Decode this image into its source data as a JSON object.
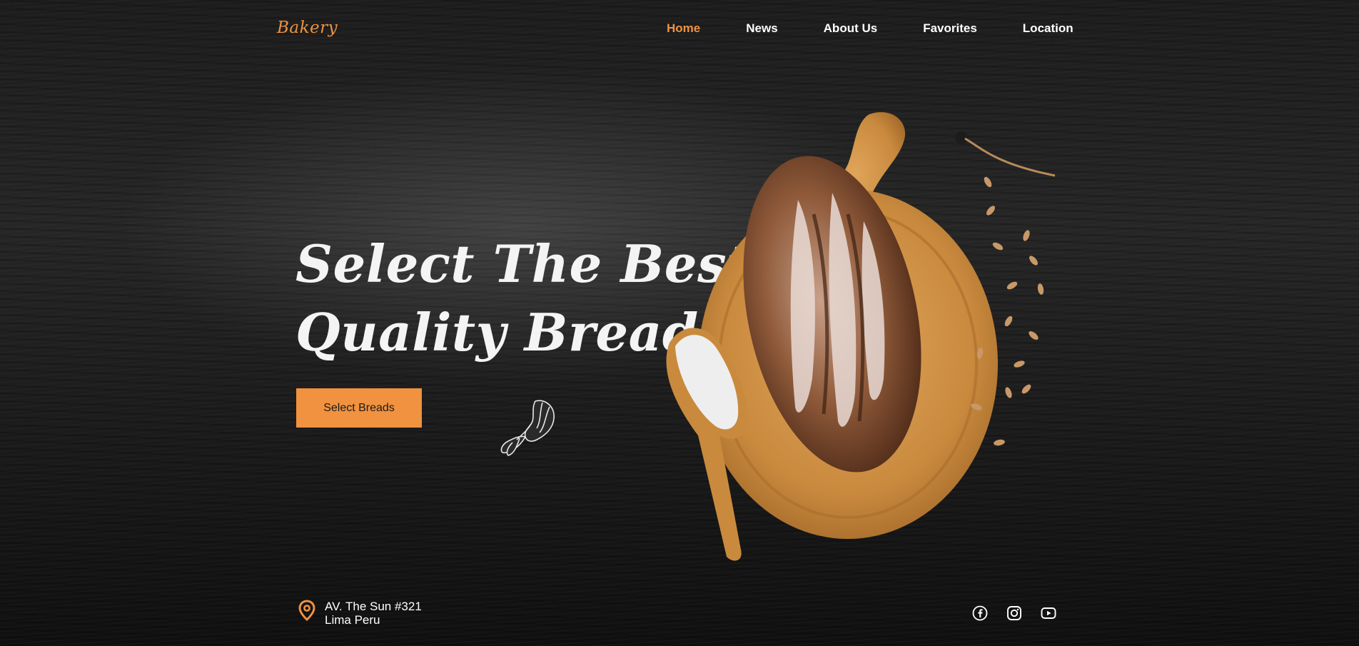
{
  "brand": {
    "logo": "Bakery"
  },
  "nav": {
    "items": [
      {
        "label": "Home",
        "active": true
      },
      {
        "label": "News",
        "active": false
      },
      {
        "label": "About Us",
        "active": false
      },
      {
        "label": "Favorites",
        "active": false
      },
      {
        "label": "Location",
        "active": false
      }
    ]
  },
  "hero": {
    "title_line1": "Select The Best",
    "title_line2": "Quality Breads",
    "cta_label": "Select Breads"
  },
  "footer": {
    "address_line1": "AV. The Sun #321",
    "address_line2": "Lima Peru",
    "socials": [
      "facebook-icon",
      "instagram-icon",
      "youtube-icon"
    ]
  },
  "colors": {
    "accent": "#f0923f",
    "background": "#1c1c1c",
    "text": "#ffffff"
  }
}
